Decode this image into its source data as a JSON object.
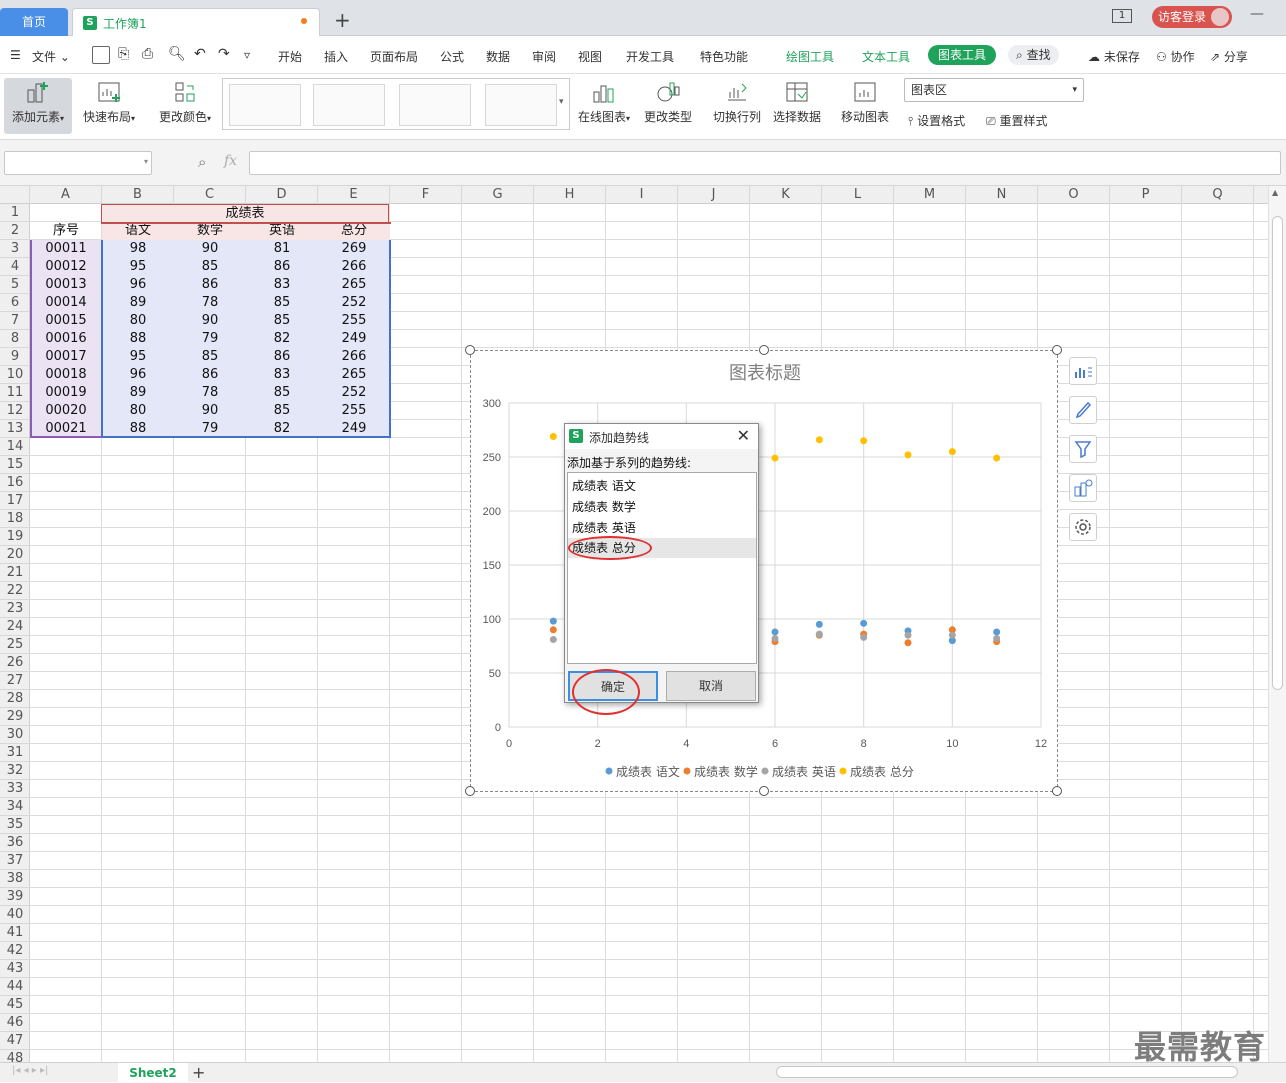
{
  "titlebar": {
    "home_tab": "首页",
    "doc_tab": "工作簿1",
    "window_count": "1",
    "login": "访客登录"
  },
  "menu": {
    "file": "文件",
    "items": [
      "开始",
      "插入",
      "页面布局",
      "公式",
      "数据",
      "审阅",
      "视图",
      "开发工具",
      "特色功能"
    ],
    "draw_tool": "绘图工具",
    "text_tool": "文本工具",
    "chart_tool": "图表工具",
    "search": "查找",
    "unsaved": "未保存",
    "collab": "协作",
    "share": "分享"
  },
  "ribbon": {
    "add_element": "添加元素",
    "quick_layout": "快速布局",
    "change_color": "更改颜色",
    "online_chart": "在线图表",
    "change_type": "更改类型",
    "switch_rowcol": "切换行列",
    "select_data": "选择数据",
    "move_chart": "移动图表",
    "chart_area_select": "图表区",
    "set_format": "设置格式",
    "reset_style": "重置样式"
  },
  "formula": {
    "fx": "fx"
  },
  "columns": [
    "A",
    "B",
    "C",
    "D",
    "E",
    "F",
    "G",
    "H",
    "I",
    "J",
    "K",
    "L",
    "M",
    "N",
    "O",
    "P",
    "Q"
  ],
  "row_count": 48,
  "table": {
    "title": "成绩表",
    "headers": [
      "序号",
      "语文",
      "数学",
      "英语",
      "总分"
    ],
    "rows": [
      [
        "00011",
        "98",
        "90",
        "81",
        "269"
      ],
      [
        "00012",
        "95",
        "85",
        "86",
        "266"
      ],
      [
        "00013",
        "96",
        "86",
        "83",
        "265"
      ],
      [
        "00014",
        "89",
        "78",
        "85",
        "252"
      ],
      [
        "00015",
        "80",
        "90",
        "85",
        "255"
      ],
      [
        "00016",
        "88",
        "79",
        "82",
        "249"
      ],
      [
        "00017",
        "95",
        "85",
        "86",
        "266"
      ],
      [
        "00018",
        "96",
        "86",
        "83",
        "265"
      ],
      [
        "00019",
        "89",
        "78",
        "85",
        "252"
      ],
      [
        "00020",
        "80",
        "90",
        "85",
        "255"
      ],
      [
        "00021",
        "88",
        "79",
        "82",
        "249"
      ]
    ]
  },
  "chart_data": {
    "type": "scatter",
    "title": "图表标题",
    "xlabel": "",
    "ylabel": "",
    "xlim": [
      0,
      12
    ],
    "ylim": [
      0,
      300
    ],
    "xticks": [
      0,
      2,
      4,
      6,
      8,
      10,
      12
    ],
    "yticks": [
      0,
      50,
      100,
      150,
      200,
      250,
      300
    ],
    "grid": true,
    "legend_position": "bottom",
    "x": [
      1,
      2,
      3,
      4,
      5,
      6,
      7,
      8,
      9,
      10,
      11
    ],
    "series": [
      {
        "name": "成绩表 语文",
        "color": "#5b9bd5",
        "values": [
          98,
          95,
          96,
          89,
          80,
          88,
          95,
          96,
          89,
          80,
          88
        ]
      },
      {
        "name": "成绩表 数学",
        "color": "#ed7d31",
        "values": [
          90,
          85,
          86,
          78,
          90,
          79,
          85,
          86,
          78,
          90,
          79
        ]
      },
      {
        "name": "成绩表 英语",
        "color": "#a5a5a5",
        "values": [
          81,
          86,
          83,
          85,
          85,
          82,
          86,
          83,
          85,
          85,
          82
        ]
      },
      {
        "name": "成绩表 总分",
        "color": "#ffc000",
        "values": [
          269,
          266,
          265,
          252,
          255,
          249,
          266,
          265,
          252,
          255,
          249
        ]
      }
    ]
  },
  "dialog": {
    "title": "添加趋势线",
    "prompt": "添加基于系列的趋势线:",
    "options": [
      "成绩表 语文",
      "成绩表 数学",
      "成绩表 英语",
      "成绩表 总分"
    ],
    "selected_index": 3,
    "ok": "确定",
    "cancel": "取消"
  },
  "sheet": {
    "tab": "Sheet2"
  },
  "watermark": "最需教育"
}
